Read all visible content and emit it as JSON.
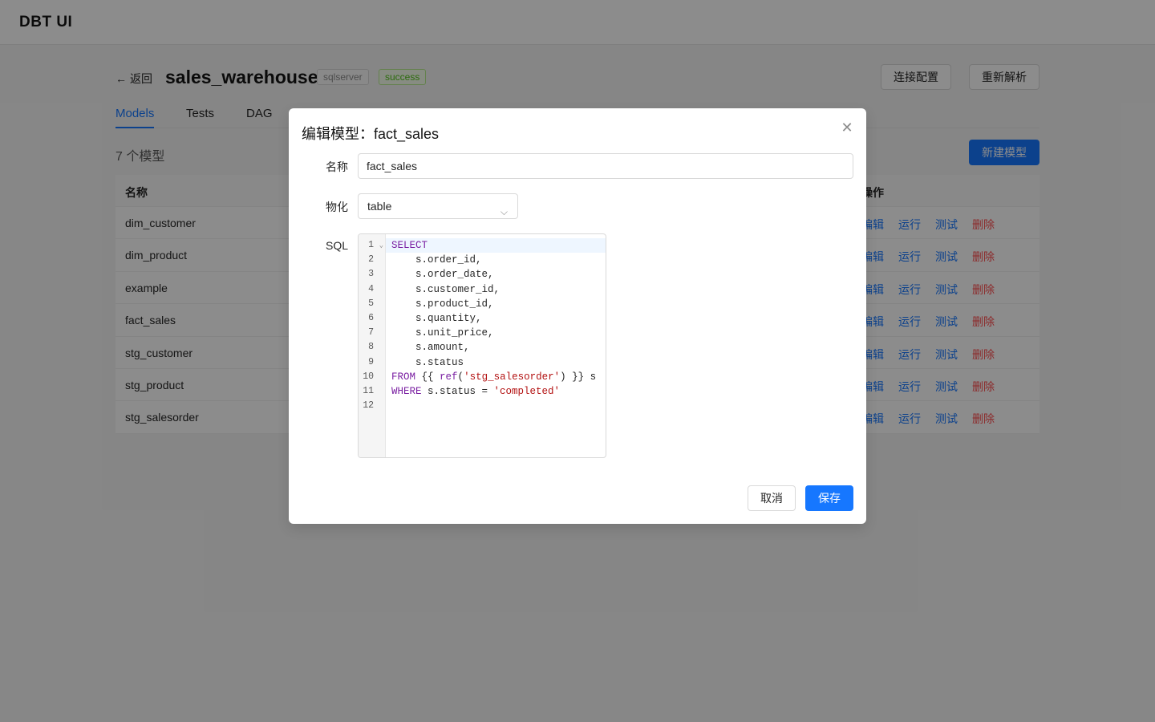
{
  "app": {
    "title": "DBT UI"
  },
  "project": {
    "back_label": "返回",
    "name": "sales_warehouse",
    "db_type": "sqlserver",
    "status": "success",
    "connection_button": "连接配置",
    "reparse_button": "重新解析"
  },
  "tabs": [
    {
      "label": "Models",
      "active": true
    },
    {
      "label": "Tests",
      "active": false
    },
    {
      "label": "DAG",
      "active": false
    }
  ],
  "models_section": {
    "count_label": "7 个模型",
    "new_button": "新建模型",
    "columns": {
      "name": "名称",
      "ops": "操作"
    },
    "rows": [
      {
        "name": "dim_customer"
      },
      {
        "name": "dim_product"
      },
      {
        "name": "example"
      },
      {
        "name": "fact_sales"
      },
      {
        "name": "stg_customer"
      },
      {
        "name": "stg_product"
      },
      {
        "name": "stg_salesorder"
      }
    ],
    "row_actions": {
      "edit": "编辑",
      "run": "运行",
      "test": "测试",
      "delete": "删除"
    }
  },
  "modal": {
    "title": "编辑模型：fact_sales",
    "name_label": "名称",
    "name_value": "fact_sales",
    "materialization_label": "物化",
    "materialization_value": "table",
    "sql_label": "SQL",
    "code_lines": [
      "SELECT",
      "    s.order_id,",
      "    s.order_date,",
      "    s.customer_id,",
      "    s.product_id,",
      "    s.quantity,",
      "    s.unit_price,",
      "    s.amount,",
      "    s.status",
      "FROM {{ ref('stg_salesorder') }} s",
      "WHERE s.status = 'completed'",
      ""
    ],
    "cancel_button": "取消",
    "save_button": "保存"
  },
  "colors": {
    "primary": "#1677ff",
    "danger": "#ff4d4f",
    "success": "#52c41a"
  }
}
